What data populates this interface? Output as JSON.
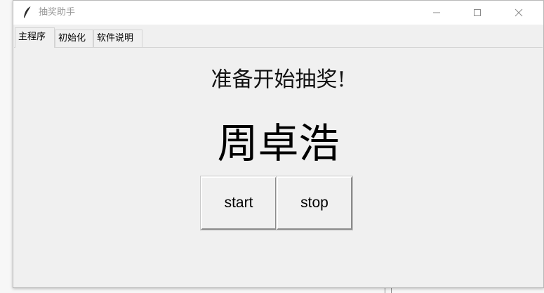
{
  "window": {
    "title": "抽奖助手",
    "controls": {
      "minimize": "minimize-icon",
      "maximize": "maximize-icon",
      "close": "close-icon"
    }
  },
  "tabs": [
    {
      "label": "主程序",
      "active": true
    },
    {
      "label": "初始化",
      "active": false
    },
    {
      "label": "软件说明",
      "active": false
    }
  ],
  "main": {
    "status_text": "准备开始抽奖!",
    "winner_name": "周卓浩",
    "start_label": "start",
    "stop_label": "stop"
  },
  "colors": {
    "window_bg": "#f0f0f0",
    "titlebar_bg": "#ffffff",
    "title_text": "#9a9a9a"
  }
}
